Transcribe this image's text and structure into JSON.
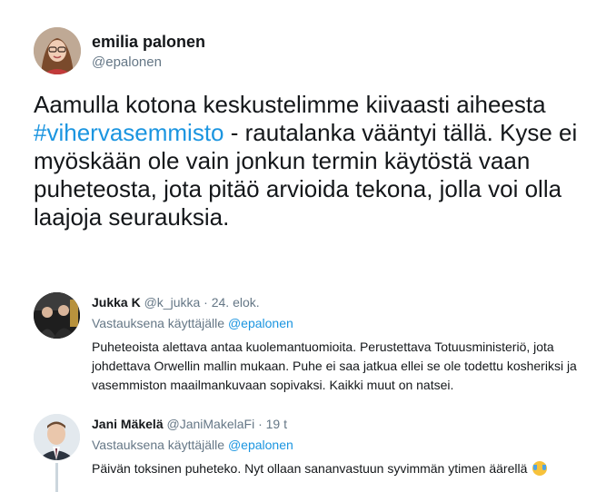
{
  "tweet": {
    "author_name": "emilia palonen",
    "author_handle": "@epalonen",
    "text_before": "Aamulla kotona keskustelimme kiivaasti aiheesta ",
    "hashtag": "#vihervasemmisto",
    "text_after": " - rautalanka vääntyi tällä. Kyse ei myöskään ole vain jonkun termin käytöstä vaan puheteosta, jota pitäö arvioida tekona, jolla voi olla laajoja seurauksia."
  },
  "replies": [
    {
      "name": "Jukka K",
      "handle": "@k_jukka",
      "separator": "·",
      "time": "24. elok.",
      "replying_prefix": "Vastauksena käyttäjälle",
      "replying_to": "@epalonen",
      "text": "Puheteoista alettava antaa kuolemantuomioita. Perustettava Totuusministeriö, jota johdettava Orwellin mallin mukaan. Puhe ei saa jatkua ellei se ole todettu kosheriksi ja vasemmiston maailmankuvaan sopivaksi. Kaikki muut on natsei."
    },
    {
      "name": "Jani Mäkelä",
      "handle": "@JaniMakelaFi",
      "separator": "·",
      "time": "19 t",
      "replying_prefix": "Vastauksena käyttäjälle",
      "replying_to": "@epalonen",
      "text": "Päivän toksinen puheteko. Nyt ollaan sananvastuun syvimmän ytimen äärellä",
      "emoji": "tears-of-joy-emoji"
    }
  ],
  "colors": {
    "link": "#1b95e0",
    "secondary_text": "#657786",
    "primary_text": "#14171a",
    "thread_line": "#ccd6dd"
  }
}
